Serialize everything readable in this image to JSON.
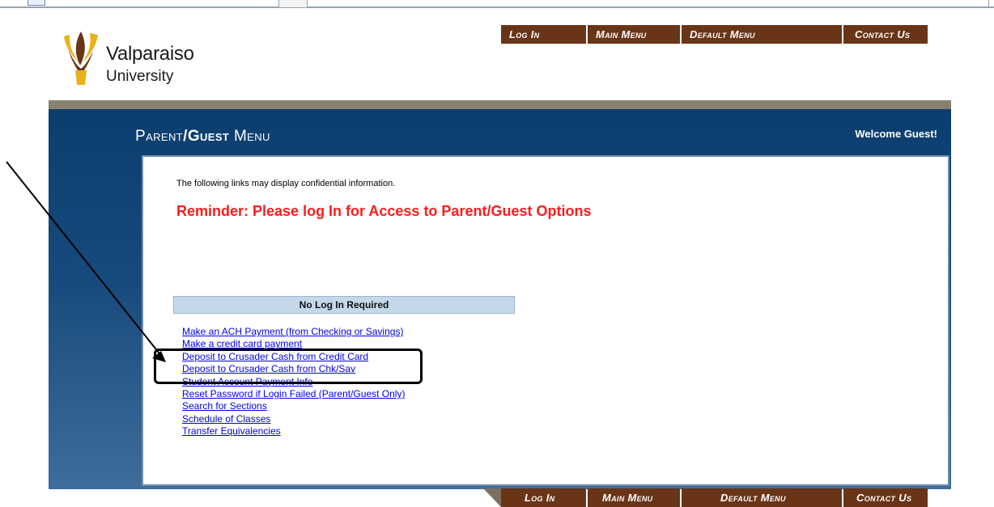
{
  "brand": {
    "name_line1": "Valparaiso",
    "name_line2": "University",
    "colors": {
      "gold": "#e8b21c",
      "brown": "#6a3417",
      "navy": "#0c3d6f"
    }
  },
  "nav_top": {
    "login": "Log In",
    "main_menu": "Main Menu",
    "default_menu": "Default Menu",
    "contact_us": "Contact Us"
  },
  "nav_bottom": {
    "login": "Log In",
    "main_menu": "Main Menu",
    "default_menu": "Default Menu",
    "contact_us": "Contact Us"
  },
  "header": {
    "title_part1": "Parent",
    "title_sep": "/",
    "title_part2": "Guest",
    "title_part3": " Menu",
    "welcome": "Welcome Guest!"
  },
  "content": {
    "confidential_note": "The following links may display confidential information.",
    "reminder": "Reminder: Please log In for Access to Parent/Guest Options",
    "section_header": "No Log In Required",
    "links": [
      "Make an ACH Payment (from Checking or Savings)",
      "Make a credit card payment",
      "Deposit to Crusader Cash from Credit Card",
      "Deposit to Crusader Cash from Chk/Sav",
      "Student Account Payment Info",
      "Reset Password if Login Failed (Parent/Guest Only)",
      "Search for Sections",
      "Schedule of Classes",
      "Transfer Equivalencies"
    ]
  }
}
